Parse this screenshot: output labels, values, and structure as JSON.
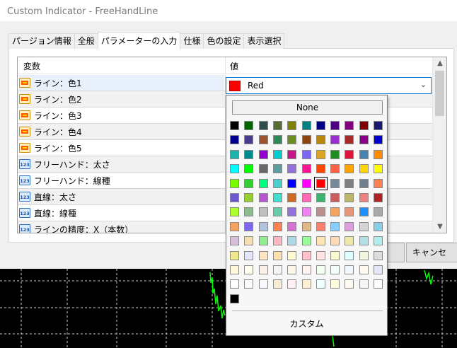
{
  "window": {
    "title": "Custom Indicator - FreeHandLine"
  },
  "tabs": [
    {
      "label": "パージョン情報",
      "active": false
    },
    {
      "label": "全般",
      "active": false
    },
    {
      "label": "パラメーターの入力",
      "active": true
    },
    {
      "label": "仕様",
      "active": false
    },
    {
      "label": "色の設定",
      "active": false
    },
    {
      "label": "表示選択",
      "active": false
    }
  ],
  "grid": {
    "header": {
      "name": "変数",
      "value": "値"
    },
    "rows": [
      {
        "label": "ライン：色1",
        "icon": "color-icon",
        "selected": true
      },
      {
        "label": "ライン：色2",
        "icon": "color-icon"
      },
      {
        "label": "ライン：色3",
        "icon": "color-icon"
      },
      {
        "label": "ライン：色4",
        "icon": "color-icon"
      },
      {
        "label": "ライン：色5",
        "icon": "color-icon"
      },
      {
        "label": "フリーハンド：太さ",
        "icon": "integer-icon"
      },
      {
        "label": "フリーハンド：線種",
        "icon": "integer-icon"
      },
      {
        "label": "直線：太さ",
        "icon": "integer-icon"
      },
      {
        "label": "直線：線種",
        "icon": "integer-icon"
      },
      {
        "label": "ラインの精度：X（本数）",
        "icon": "integer-icon"
      }
    ],
    "icon_text": "123"
  },
  "combo": {
    "value": "Red",
    "swatch_color": "#ff0000"
  },
  "popup": {
    "none_label": "None",
    "custom_label": "カスタム",
    "selected_color": "#ff0000",
    "palette": [
      [
        "#000000",
        "#006400",
        "#2f4f4f",
        "#556b2f",
        "#808000",
        "#008080",
        "#000080",
        "#4b0082",
        "#800080",
        "#800000",
        "#191970"
      ],
      [
        "#00008b",
        "#483d8b",
        "#a0522d",
        "#2e8b57",
        "#6b8e23",
        "#8b4513",
        "#b8860b",
        "#9932cc",
        "#a52a2a",
        "#8b008b",
        "#0000cd"
      ],
      [
        "#20b2aa",
        "#008b8b",
        "#9400d3",
        "#00ced1",
        "#c71585",
        "#7b68ee",
        "#daa520",
        "#228b22",
        "#dc143c",
        "#4682b4",
        "#ff8c00"
      ],
      [
        "#00ffff",
        "#00ff00",
        "#696969",
        "#5f9ea0",
        "#9370db",
        "#ff1493",
        "#ff4500",
        "#ff6347",
        "#ffa500",
        "#ffd700",
        "#ffff00"
      ],
      [
        "#7cfc00",
        "#32cd32",
        "#00ff7f",
        "#48d1cc",
        "#0000ff",
        "#ff00ff",
        "#ff0000",
        "#778899",
        "#808080",
        "#708090",
        "#ff7f50"
      ],
      [
        "#6a5acd",
        "#9acd32",
        "#ba55d3",
        "#40e0d0",
        "#d2691e",
        "#ff69b4",
        "#3cb371",
        "#cd5c5c",
        "#bdb76b",
        "#f08080",
        "#b22222"
      ],
      [
        "#adff2f",
        "#8fbc8f",
        "#c0c0c0",
        "#66cdaa",
        "#9370db",
        "#ee82ee",
        "#bc8f8f",
        "#f4a460",
        "#e9967a",
        "#1e90ff",
        "#a9a9a9"
      ],
      [
        "#f4a460",
        "#7b68ee",
        "#b0c4de",
        "#ff7f50",
        "#da70d6",
        "#deb887",
        "#fa8072",
        "#87cefa",
        "#dda0dd",
        "#d3d3d3",
        "#87ceeb"
      ],
      [
        "#d8bfd8",
        "#f5deb3",
        "#90ee90",
        "#ffb6c1",
        "#add8e6",
        "#98fb98",
        "#ffe4b5",
        "#ffdab9",
        "#eee8aa",
        "#b0e0e6",
        "#afeeee"
      ],
      [
        "#f0e68c",
        "#e6e6fa",
        "#ffe4c4",
        "#ffdead",
        "#fffacd",
        "#ffc0cb",
        "#ffe4e1",
        "#fafad2",
        "#e0ffff",
        "#f5f5dc",
        "#dcdcdc"
      ],
      [
        "#fff8dc",
        "#fffff0",
        "#faf0e6",
        "#f5f5f5",
        "#fdf5e6",
        "#fff5ee",
        "#f0fff0",
        "#f5fffa",
        "#f0f8ff",
        "#fffaf0",
        "#e6e6fa"
      ],
      [
        "#ffffff",
        "#fffafa",
        "#f8f8ff",
        "#faebd7",
        "#fff0f5",
        "#ffefd5",
        "#f0ffff",
        "#ffffe0",
        "#fffaf0",
        "#f5f5f5",
        "#ffffff"
      ],
      [
        "#000000"
      ]
    ]
  },
  "buttons": {
    "cancel": "キャンセ"
  },
  "colors": {
    "accent": "#0078d7",
    "chart_bg": "#000000",
    "chart_line": "#00ff00"
  }
}
